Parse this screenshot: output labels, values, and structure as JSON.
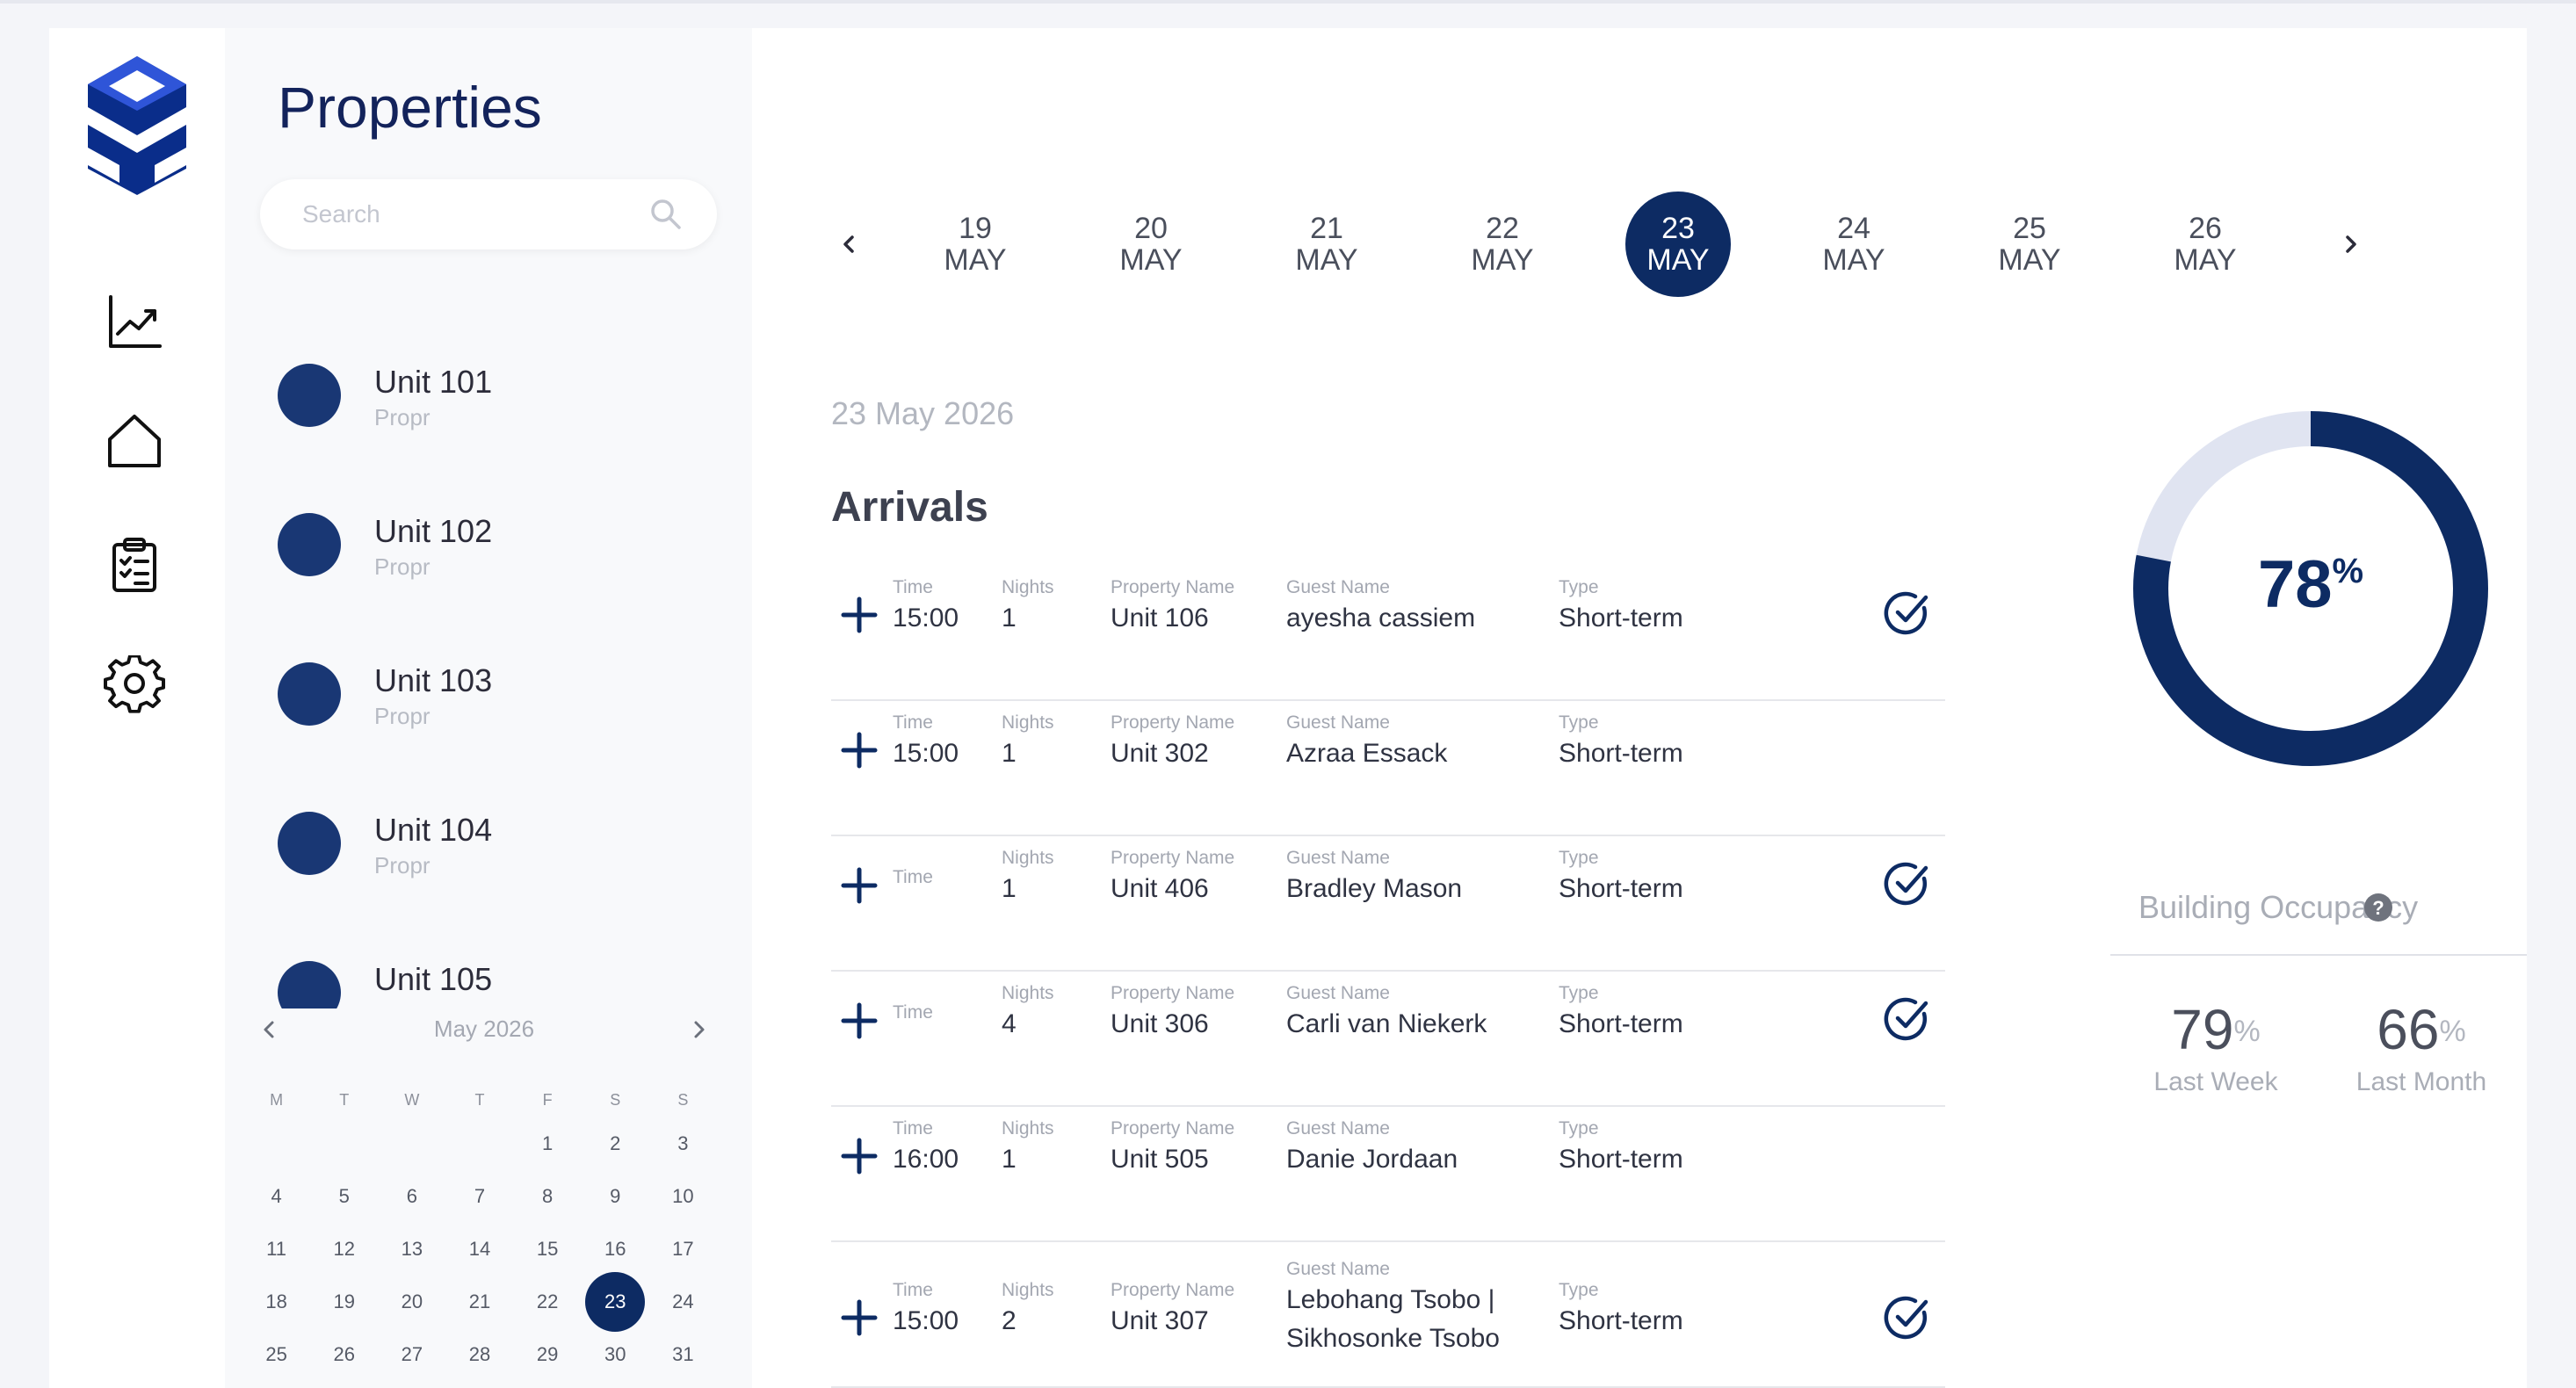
{
  "app": {
    "accent": "#0d2b63"
  },
  "properties": {
    "title": "Properties",
    "search_placeholder": "Search",
    "units": [
      {
        "name": "Unit 101",
        "sub": "Propr"
      },
      {
        "name": "Unit 102",
        "sub": "Propr"
      },
      {
        "name": "Unit 103",
        "sub": "Propr"
      },
      {
        "name": "Unit 104",
        "sub": "Propr"
      },
      {
        "name": "Unit 105",
        "sub": ""
      }
    ]
  },
  "calendar": {
    "month": "May 2026",
    "weekdays": [
      "M",
      "T",
      "W",
      "T",
      "F",
      "S",
      "S"
    ],
    "rows": [
      [
        "",
        "",
        "",
        "",
        "1",
        "2",
        "3"
      ],
      [
        "4",
        "5",
        "6",
        "7",
        "8",
        "9",
        "10"
      ],
      [
        "11",
        "12",
        "13",
        "14",
        "15",
        "16",
        "17"
      ],
      [
        "18",
        "19",
        "20",
        "21",
        "22",
        "23",
        "24"
      ],
      [
        "25",
        "26",
        "27",
        "28",
        "29",
        "30",
        "31"
      ]
    ],
    "selected": "23"
  },
  "date_strip": [
    {
      "day": "19",
      "month": "MAY",
      "active": false
    },
    {
      "day": "20",
      "month": "MAY",
      "active": false
    },
    {
      "day": "21",
      "month": "MAY",
      "active": false
    },
    {
      "day": "22",
      "month": "MAY",
      "active": false
    },
    {
      "day": "23",
      "month": "MAY",
      "active": true
    },
    {
      "day": "24",
      "month": "MAY",
      "active": false
    },
    {
      "day": "25",
      "month": "MAY",
      "active": false
    },
    {
      "day": "26",
      "month": "MAY",
      "active": false
    }
  ],
  "main": {
    "date_heading": "23 May 2026",
    "arrivals_heading": "Arrivals"
  },
  "arrivals": {
    "columns": {
      "time": "Time",
      "nights": "Nights",
      "property": "Property Name",
      "guest": "Guest Name",
      "type": "Type"
    },
    "rows": [
      {
        "time": "15:00",
        "nights": "1",
        "property": "Unit 106",
        "guest": [
          "ayesha cassiem"
        ],
        "type": "Short-term",
        "checked": true
      },
      {
        "time": "15:00",
        "nights": "1",
        "property": "Unit 302",
        "guest": [
          "Azraa Essack"
        ],
        "type": "Short-term",
        "checked": false
      },
      {
        "time": "",
        "nights": "1",
        "property": "Unit 406",
        "guest": [
          "Bradley Mason"
        ],
        "type": "Short-term",
        "checked": true
      },
      {
        "time": "",
        "nights": "4",
        "property": "Unit 306",
        "guest": [
          "Carli van Niekerk"
        ],
        "type": "Short-term",
        "checked": true
      },
      {
        "time": "16:00",
        "nights": "1",
        "property": "Unit 505",
        "guest": [
          "Danie Jordaan"
        ],
        "type": "Short-term",
        "checked": false
      },
      {
        "time": "15:00",
        "nights": "2",
        "property": "Unit 307",
        "guest": [
          "Lebohang Tsobo |",
          "Sikhosonke Tsobo"
        ],
        "type": "Short-term",
        "checked": true
      }
    ]
  },
  "occupancy": {
    "current_value": "78",
    "current_fraction": 0.78,
    "percent_sign": "%",
    "title": "Building Occupancy",
    "last_week_value": "79",
    "last_week_label": "Last Week",
    "last_month_value": "66",
    "last_month_label": "Last Month"
  }
}
